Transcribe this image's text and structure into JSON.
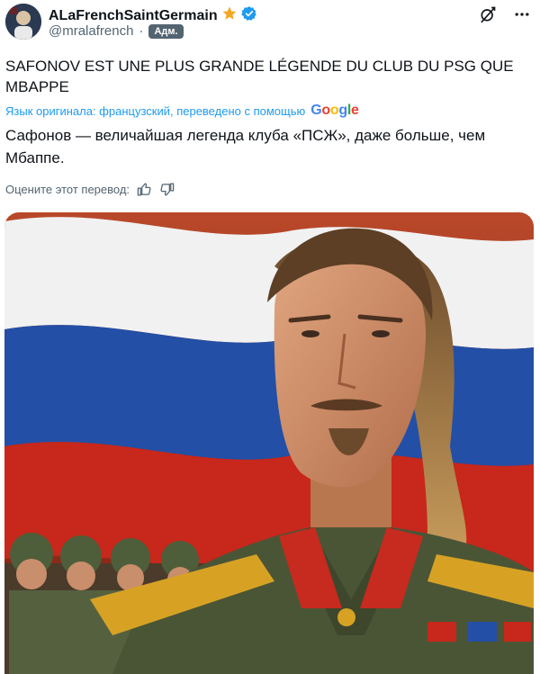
{
  "author": {
    "display_name": "ALaFrenchSaintGermain",
    "handle": "@mralafrench",
    "separator": "·",
    "role_badge": "Адм.",
    "star_badge_icon": "star-icon",
    "verified_icon": "verified-badge-icon"
  },
  "top_actions": {
    "grok_icon": "grok-icon",
    "more_icon": "more-icon"
  },
  "tweet": {
    "original_text": "SAFONOV EST UNE PLUS GRANDE LÉGENDE DU CLUB DU PSG QUE MBAPPE",
    "translation_label": "Язык оригинала: французский, переведено с помощью",
    "translation_provider": "Google",
    "translated_text": "Сафонов — величайшая легенда клуба «ПСЖ», даже больше, чем Мбаппе.",
    "rate_label": "Оцените этот перевод:"
  },
  "media": {
    "image_icon": "photo-image",
    "flag_colors": [
      "#f4f4f4",
      "#1f4fa8",
      "#c4281c"
    ],
    "background_color": "#b23a1f"
  }
}
